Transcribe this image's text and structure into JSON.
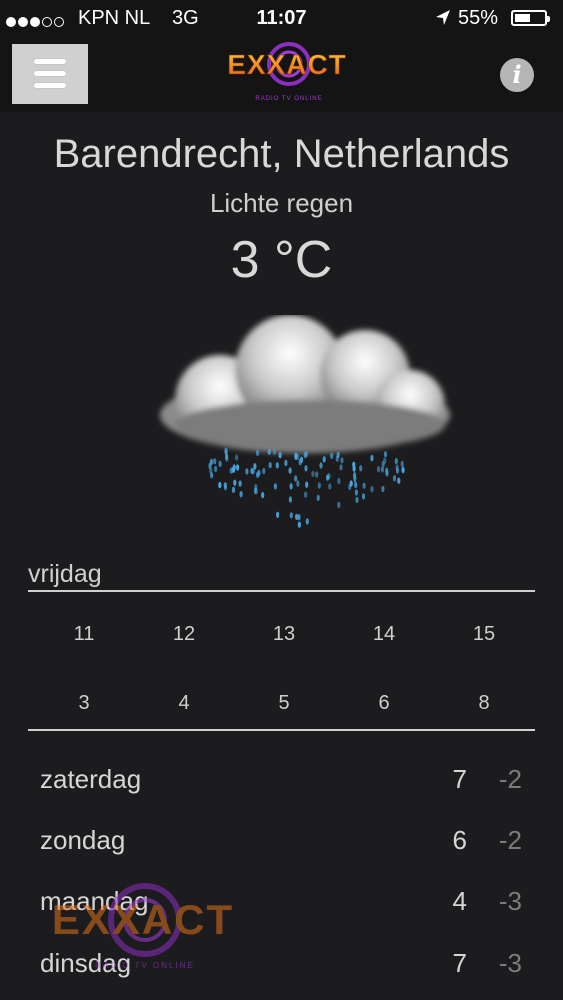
{
  "status_bar": {
    "carrier": "KPN NL",
    "network": "3G",
    "time": "11:07",
    "battery": "55%",
    "battery_level": 0.55,
    "signal_bars_filled": 3,
    "signal_bars_total": 5
  },
  "header": {
    "logo_text": "EXXACT",
    "logo_tagline": "RADIO  TV  ONLINE",
    "menu_icon": "hamburger-icon",
    "info_icon": "info-icon",
    "info_glyph": "i"
  },
  "weather": {
    "location": "Barendrecht, Netherlands",
    "condition": "Lichte regen",
    "temperature": "3 °C",
    "icon": "rain-cloud-icon"
  },
  "today": {
    "day": "vrijdag",
    "hours": [
      "11",
      "12",
      "13",
      "14",
      "15"
    ],
    "temps": [
      "3",
      "4",
      "5",
      "6",
      "8"
    ]
  },
  "forecast": [
    {
      "day": "zaterdag",
      "high": "7",
      "low": "-2"
    },
    {
      "day": "zondag",
      "high": "6",
      "low": "-2"
    },
    {
      "day": "maandag",
      "high": "4",
      "low": "-3"
    },
    {
      "day": "dinsdag",
      "high": "7",
      "low": "-3"
    }
  ],
  "colors": {
    "background": "#1c1c1e",
    "logo_orange": "#f08a1a",
    "logo_purple": "#a43bd8",
    "rain_blue": "#4aa8e0"
  }
}
